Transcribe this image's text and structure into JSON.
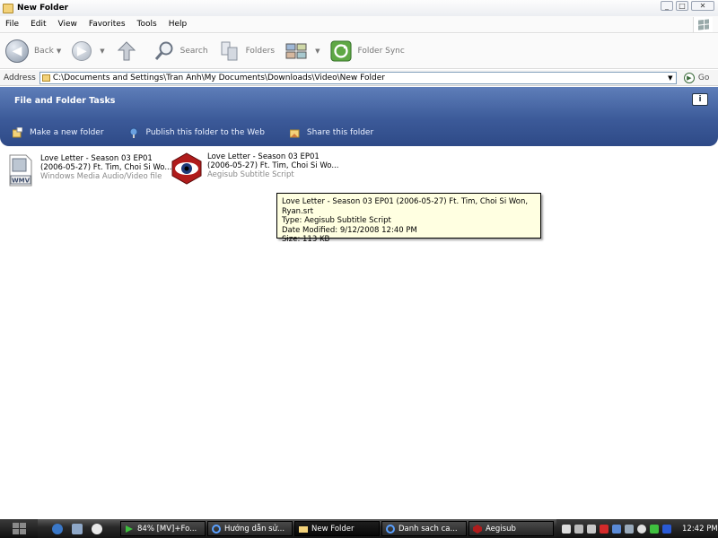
{
  "window": {
    "title": "New Folder"
  },
  "menu": [
    "File",
    "Edit",
    "View",
    "Favorites",
    "Tools",
    "Help"
  ],
  "toolbar": {
    "back_label": "Back",
    "search_label": "Search",
    "folders_label": "Folders",
    "foldersync_label": "Folder Sync"
  },
  "address": {
    "label": "Address",
    "path": "C:\\Documents and Settings\\Tran Anh\\My Documents\\Downloads\\Video\\New Folder",
    "go_label": "Go"
  },
  "taskpane": {
    "title": "File and Folder Tasks",
    "tasks": [
      "Make a new folder",
      "Publish this folder to the Web",
      "Share this folder"
    ]
  },
  "files": [
    {
      "name_line1": "Love Letter - Season 03 EP01",
      "name_line2": "(2006-05-27) Ft. Tim, Choi Si Wo...",
      "type": "Windows Media Audio/Video file",
      "icon": "wmv-file-icon"
    },
    {
      "name_line1": "Love Letter - Season 03 EP01",
      "name_line2": "(2006-05-27) Ft. Tim, Choi Si Wo...",
      "type": "Aegisub Subtitle Script",
      "icon": "aegisub-icon"
    }
  ],
  "tooltip": {
    "line1": "Love Letter - Season 03 EP01 (2006-05-27) Ft. Tim, Choi Si Won, Ryan.srt",
    "line2": "Type: Aegisub Subtitle Script",
    "line3": "Date Modified: 9/12/2008 12:40 PM",
    "line4": "Size: 113 KB"
  },
  "taskbar": {
    "tasks": [
      {
        "label": "84% [MV]+Fo...",
        "icon": "download-arrow-icon",
        "active": false
      },
      {
        "label": "Hướng dẫn sử...",
        "icon": "ie-icon",
        "active": false
      },
      {
        "label": "New Folder",
        "icon": "folder-icon",
        "active": true
      },
      {
        "label": "Danh sach ca...",
        "icon": "ie-icon",
        "active": false
      },
      {
        "label": "Aegisub",
        "icon": "aegisub-icon",
        "active": false
      }
    ],
    "clock": "12:42 PM"
  },
  "colors": {
    "taskpane": "#3c5a99",
    "tooltip_bg": "#ffffe1",
    "taskbar": "#1e1e1e"
  }
}
